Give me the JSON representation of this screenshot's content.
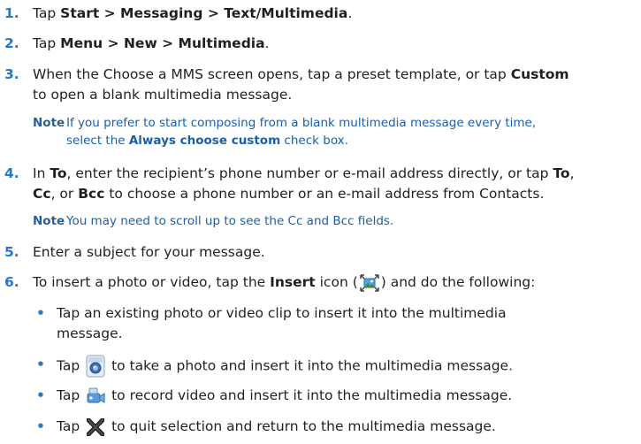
{
  "steps": [
    {
      "num": "1.",
      "pre": "Tap ",
      "bold": "Start > Messaging > Text/Multimedia",
      "post": "."
    },
    {
      "num": "2.",
      "pre": "Tap ",
      "bold": "Menu > New > Multimedia",
      "post": "."
    },
    {
      "num": "3.",
      "line1_pre": "When the Choose a MMS screen opens, tap a preset template, or tap ",
      "line1_bold": "Custom",
      "line2": "to open a blank multimedia message."
    },
    {
      "num": "4.",
      "line1_a": "In ",
      "line1_b": "To",
      "line1_c": ", enter the recipient’s phone number or e-mail address directly, or tap ",
      "line1_d": "To",
      "line1_e": ",",
      "line2_a": "Cc",
      "line2_b": ", or ",
      "line2_c": "Bcc",
      "line2_d": " to choose a phone number or an e-mail address from Contacts."
    },
    {
      "num": "5.",
      "text": "Enter a subject for your message."
    },
    {
      "num": "6.",
      "pre": "To insert a photo or video, tap the ",
      "bold": "Insert",
      "mid": " icon (",
      "post": ") and do the following:"
    }
  ],
  "notes": [
    {
      "label": "Note",
      "line1": "If you prefer to start composing from a blank multimedia message every time,",
      "line2_pre": "select the ",
      "line2_bold": "Always choose custom",
      "line2_post": " check box."
    },
    {
      "label": "Note",
      "line1": "You may need to scroll up to see the Cc and Bcc fields."
    }
  ],
  "bullets": [
    {
      "dot": "•",
      "line1": "Tap an existing photo or video clip to insert it into the multimedia",
      "line2": "message."
    },
    {
      "dot": "•",
      "pre": "Tap ",
      "post": " to take a photo and insert it into the multimedia message.",
      "icon": "camera-icon"
    },
    {
      "dot": "•",
      "pre": "Tap ",
      "post": " to record video and insert it into the multimedia message.",
      "icon": "video-camera-icon"
    },
    {
      "dot": "•",
      "pre": "Tap ",
      "post": " to quit selection and return to the multimedia message.",
      "icon": "close-x-icon"
    }
  ],
  "colors": {
    "number": "#2878c8",
    "note": "#1b5fa8",
    "text": "#231f20"
  }
}
